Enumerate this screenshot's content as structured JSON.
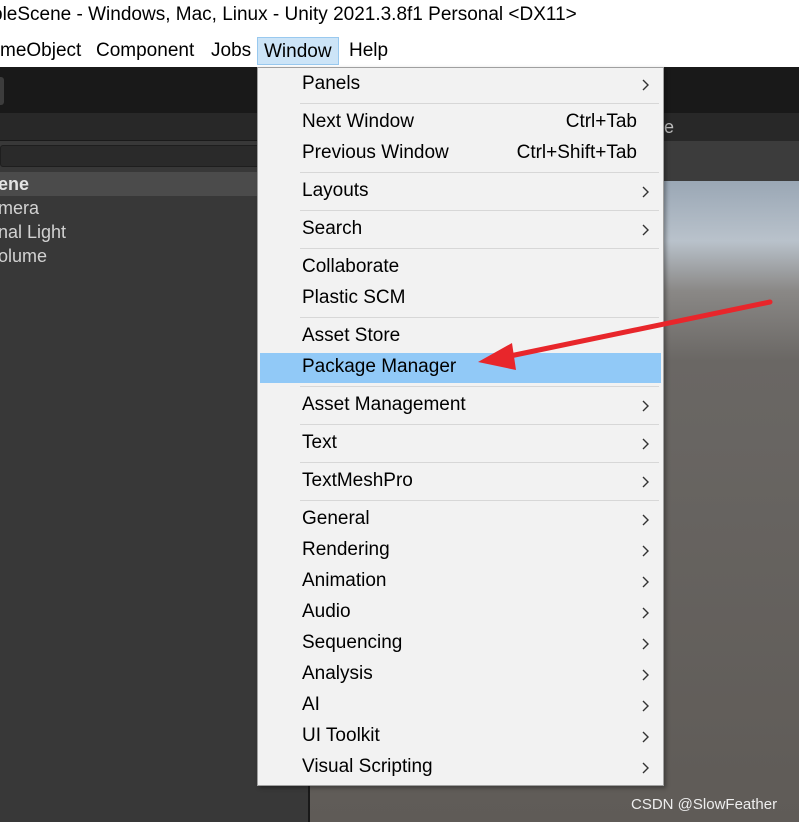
{
  "window": {
    "title": "pleScene - Windows, Mac, Linux - Unity 2021.3.8f1 Personal <DX11>"
  },
  "menubar": {
    "gameobject": "meObject",
    "component": "Component",
    "jobs": "Jobs",
    "window": "Window",
    "help": "Help"
  },
  "hierarchy": {
    "rows": [
      "ene",
      "mera",
      "nal Light",
      "olume"
    ]
  },
  "scene": {
    "tab_partial": "e"
  },
  "dropdown": {
    "items": [
      {
        "label": "Panels",
        "submenu": true
      },
      {
        "label": "Next Window",
        "shortcut": "Ctrl+Tab"
      },
      {
        "label": "Previous Window",
        "shortcut": "Ctrl+Shift+Tab"
      },
      {
        "label": "Layouts",
        "submenu": true
      },
      {
        "label": "Search",
        "submenu": true
      },
      {
        "label": "Collaborate"
      },
      {
        "label": "Plastic SCM"
      },
      {
        "label": "Asset Store"
      },
      {
        "label": "Package Manager",
        "highlighted": true
      },
      {
        "label": "Asset Management",
        "submenu": true
      },
      {
        "label": "Text",
        "submenu": true
      },
      {
        "label": "TextMeshPro",
        "submenu": true
      },
      {
        "label": "General",
        "submenu": true
      },
      {
        "label": "Rendering",
        "submenu": true
      },
      {
        "label": "Animation",
        "submenu": true
      },
      {
        "label": "Audio",
        "submenu": true
      },
      {
        "label": "Sequencing",
        "submenu": true
      },
      {
        "label": "Analysis",
        "submenu": true
      },
      {
        "label": "AI",
        "submenu": true
      },
      {
        "label": "UI Toolkit",
        "submenu": true
      },
      {
        "label": "Visual Scripting",
        "submenu": true
      }
    ]
  },
  "watermark": "CSDN @SlowFeather",
  "colors": {
    "highlight": "#91c9f7",
    "annotation_arrow": "#e8262b",
    "menu_active": "#cce4f7"
  }
}
